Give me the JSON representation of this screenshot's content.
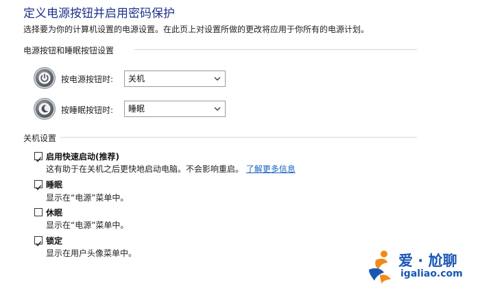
{
  "header": {
    "title": "定义电源按钮并启用密码保护",
    "subtitle": "选择要为你的计算机设置的电源设置。在此页上对设置所做的更改将应用于你所有的电源计划。"
  },
  "power_buttons_section": {
    "label": "电源按钮和睡眠按钮设置",
    "rows": [
      {
        "label": "按电源按钮时:",
        "value": "关机",
        "icon": "power-icon"
      },
      {
        "label": "按睡眠按钮时:",
        "value": "睡眠",
        "icon": "moon-icon"
      }
    ]
  },
  "shutdown_section": {
    "label": "关机设置",
    "items": [
      {
        "label": "启用快速启动(推荐)",
        "desc": "这有助于在关机之后更快地启动电脑。不会影响重启。",
        "link": "了解更多信息",
        "checked": true
      },
      {
        "label": "睡眠",
        "desc": "显示在“电源”菜单中。",
        "checked": true
      },
      {
        "label": "休眠",
        "desc": "显示在“电源”菜单中。",
        "checked": false
      },
      {
        "label": "锁定",
        "desc": "显示在用户头像菜单中。",
        "checked": true
      }
    ]
  },
  "watermark": {
    "brand": "爱 · 尬聊",
    "url": "igaliao.com"
  },
  "colors": {
    "title": "#1e3287",
    "link": "#1a62c5",
    "watermark_blue": "#1a56b5",
    "watermark_orange": "#f08a1c"
  }
}
